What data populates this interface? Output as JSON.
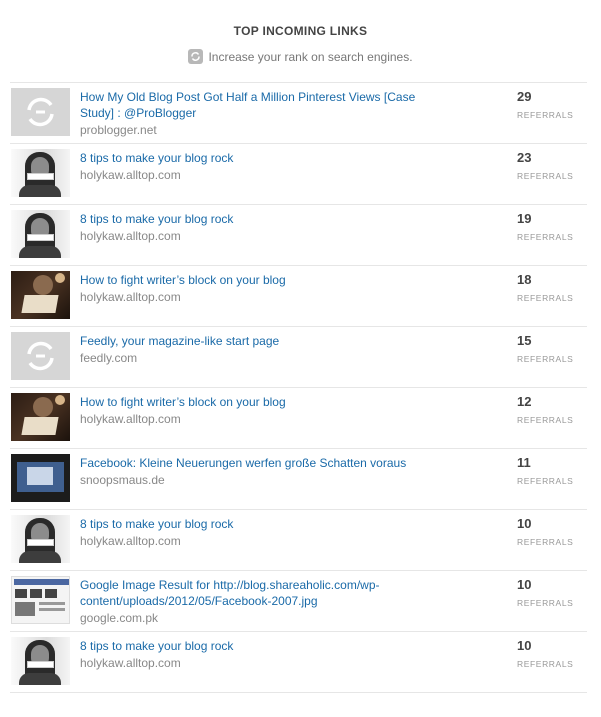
{
  "header": {
    "title": "TOP INCOMING LINKS",
    "subtitle": "Increase your rank on search engines.",
    "subtitle_icon": "refresh-icon"
  },
  "referral_label": "REFERRALS",
  "colors": {
    "link": "#1a6aa8",
    "domain": "#888888",
    "count": "#444444"
  },
  "links": [
    {
      "title": "How My Old Blog Post Got Half a Million Pinterest Views [Case Study] : @ProBlogger",
      "domain": "problogger.net",
      "count": "29",
      "thumb": "placeholder"
    },
    {
      "title": "8 tips to make your blog rock",
      "domain": "holykaw.alltop.com",
      "count": "23",
      "thumb": "person"
    },
    {
      "title": "8 tips to make your blog rock",
      "domain": "holykaw.alltop.com",
      "count": "19",
      "thumb": "person"
    },
    {
      "title": "How to fight writer’s block on your blog",
      "domain": "holykaw.alltop.com",
      "count": "18",
      "thumb": "writer"
    },
    {
      "title": "Feedly, your magazine-like start page",
      "domain": "feedly.com",
      "count": "15",
      "thumb": "placeholder"
    },
    {
      "title": "How to fight writer’s block on your blog",
      "domain": "holykaw.alltop.com",
      "count": "12",
      "thumb": "writer"
    },
    {
      "title": "Facebook: Kleine Neuerungen werfen große Schatten voraus",
      "domain": "snoopsmaus.de",
      "count": "11",
      "thumb": "screen"
    },
    {
      "title": "8 tips to make your blog rock",
      "domain": "holykaw.alltop.com",
      "count": "10",
      "thumb": "person"
    },
    {
      "title": "Google Image Result for http://blog.shareaholic.com/wp-content/uploads/2012/05/Facebook-2007.jpg",
      "domain": "google.com.pk",
      "count": "10",
      "thumb": "google"
    },
    {
      "title": "8 tips to make your blog rock",
      "domain": "holykaw.alltop.com",
      "count": "10",
      "thumb": "person"
    }
  ]
}
